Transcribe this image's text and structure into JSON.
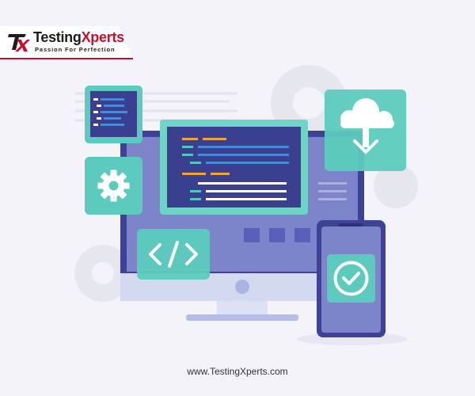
{
  "brand": {
    "name_part1": "Testing",
    "name_part2": "Xperts",
    "tagline": "Passion For Perfection",
    "colors": {
      "red": "#c8102e",
      "dark": "#1d1d1b"
    }
  },
  "footer": {
    "url": "www.TestingXperts.com"
  },
  "illustration": {
    "icons": [
      "code-window-icon",
      "gear-icon",
      "code-tag-icon",
      "cloud-download-icon",
      "checkmark-icon",
      "monitor-icon",
      "phone-icon"
    ],
    "colors": {
      "monitor": "#3d4294",
      "panel": "#4fc8c0",
      "code_bg": "#3a3f8f"
    }
  }
}
